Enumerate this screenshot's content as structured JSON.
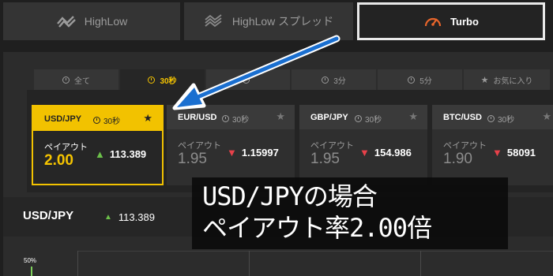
{
  "mode_tabs": [
    {
      "label": "HighLow",
      "icon": "highlow-icon"
    },
    {
      "label": "HighLow スプレッド",
      "icon": "highlow-spread-icon"
    },
    {
      "label": "Turbo",
      "icon": "speedometer-icon"
    }
  ],
  "timeframe_tabs": [
    {
      "label": "全て",
      "icon": "clock-icon"
    },
    {
      "label": "30秒",
      "icon": "clock-icon"
    },
    {
      "label": "",
      "icon": "clock-icon"
    },
    {
      "label": "3分",
      "icon": "clock-icon"
    },
    {
      "label": "5分",
      "icon": "clock-icon"
    },
    {
      "label": "お気に入り",
      "icon": "star-icon"
    }
  ],
  "cards": [
    {
      "symbol": "USD/JPY",
      "duration": "30秒",
      "payout_label": "ペイアウト",
      "payout": "2.00",
      "rate": "113.389",
      "direction": "up"
    },
    {
      "symbol": "EUR/USD",
      "duration": "30秒",
      "payout_label": "ペイアウト",
      "payout": "1.95",
      "rate": "1.15997",
      "direction": "down"
    },
    {
      "symbol": "GBP/JPY",
      "duration": "30秒",
      "payout_label": "ペイアウト",
      "payout": "1.95",
      "rate": "154.986",
      "direction": "down"
    },
    {
      "symbol": "BTC/USD",
      "duration": "30秒",
      "payout_label": "ペイアウト",
      "payout": "1.90",
      "rate": "58091",
      "direction": "down"
    }
  ],
  "selected_asset": {
    "symbol": "USD/JPY",
    "rate": "113.389"
  },
  "chart": {
    "pct_label": "50%"
  },
  "annotation": {
    "line1": "USD/JPYの場合",
    "line2": "ペイアウト率2.00倍"
  },
  "colors": {
    "accent": "#f2c200",
    "up": "#6cc04a",
    "down": "#e8414a",
    "arrow": "#1a6fd0",
    "turbo_icon": "#e8652b"
  }
}
